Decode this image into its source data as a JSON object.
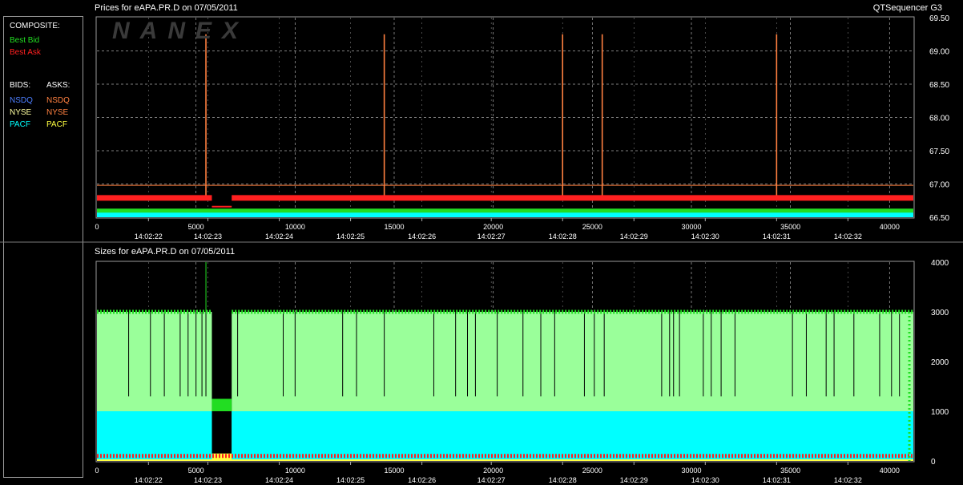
{
  "header": {
    "price_title": "Prices for  eAPA.PR.D  on  07/05/2011",
    "size_title": "Sizes for  eAPA.PR.D  on  07/05/2011",
    "app_name": "QTSequencer G3",
    "watermark": "NANEX"
  },
  "legend": {
    "composite_label": "COMPOSITE:",
    "best_bid": "Best Bid",
    "best_ask": "Best Ask",
    "bids_label": "BIDS:",
    "asks_label": "ASKS:",
    "bid_nsdq": "NSDQ",
    "bid_nyse": "NYSE",
    "bid_pacf": "PACF",
    "ask_nsdq": "NSDQ",
    "ask_nyse": "NYSE",
    "ask_pacf": "PACF"
  },
  "colors": {
    "best_bid": "#22dd22",
    "best_ask": "#ff2020",
    "nsdq_bid": "#4d7fff",
    "nsdq_ask": "#ff8040",
    "nyse_bid": "#ffffa0",
    "nyse_ask": "#ff8040",
    "pacf_bid": "#00ffff",
    "pacf_ask": "#ffff40",
    "size_bid_fill": "#9aff9a",
    "size_pacf_fill": "#00ffff"
  },
  "chart_data": [
    {
      "type": "line",
      "title": "Prices for  eAPA.PR.D  on  07/05/2011",
      "x_ticks": [
        0,
        5000,
        10000,
        15000,
        20000,
        25000,
        30000,
        35000,
        40000
      ],
      "time_ticks": [
        {
          "x": 2600,
          "label": "14:02:22"
        },
        {
          "x": 5600,
          "label": "14:02:23"
        },
        {
          "x": 9200,
          "label": "14:02:24"
        },
        {
          "x": 12800,
          "label": "14:02:25"
        },
        {
          "x": 16400,
          "label": "14:02:26"
        },
        {
          "x": 19900,
          "label": "14:02:27"
        },
        {
          "x": 23500,
          "label": "14:02:28"
        },
        {
          "x": 27100,
          "label": "14:02:29"
        },
        {
          "x": 30700,
          "label": "14:02:30"
        },
        {
          "x": 34300,
          "label": "14:02:31"
        },
        {
          "x": 37900,
          "label": "14:02:32"
        }
      ],
      "y_ticks": [
        66.5,
        67.0,
        67.5,
        68.0,
        68.5,
        69.0,
        69.5
      ],
      "xlim": [
        0,
        41200
      ],
      "ylim": [
        66.5,
        69.5
      ],
      "series": [
        {
          "name": "Best Ask",
          "y": 66.79
        },
        {
          "name": "Best Bid",
          "y": 66.6
        }
      ],
      "ask_spikes": [
        5500,
        14500,
        23500,
        25500,
        34300
      ],
      "spike_top": 69.25,
      "baseline": 66.98
    },
    {
      "type": "area",
      "title": "Sizes for  eAPA.PR.D  on  07/05/2011",
      "x_ticks": [
        0,
        5000,
        10000,
        15000,
        20000,
        25000,
        30000,
        35000,
        40000
      ],
      "time_ticks": [
        {
          "x": 2600,
          "label": "14:02:22"
        },
        {
          "x": 5600,
          "label": "14:02:23"
        },
        {
          "x": 9200,
          "label": "14:02:24"
        },
        {
          "x": 12800,
          "label": "14:02:25"
        },
        {
          "x": 16400,
          "label": "14:02:26"
        },
        {
          "x": 19900,
          "label": "14:02:27"
        },
        {
          "x": 23500,
          "label": "14:02:28"
        },
        {
          "x": 27100,
          "label": "14:02:29"
        },
        {
          "x": 30700,
          "label": "14:02:30"
        },
        {
          "x": 34300,
          "label": "14:02:31"
        },
        {
          "x": 37900,
          "label": "14:02:32"
        }
      ],
      "y_ticks": [
        0,
        1000,
        2000,
        3000,
        4000
      ],
      "xlim": [
        0,
        41200
      ],
      "ylim": [
        0,
        4000
      ],
      "bid_size": 3000,
      "pacf_size": 1000,
      "ask_size": 100,
      "gap": [
        5800,
        6800
      ]
    }
  ]
}
